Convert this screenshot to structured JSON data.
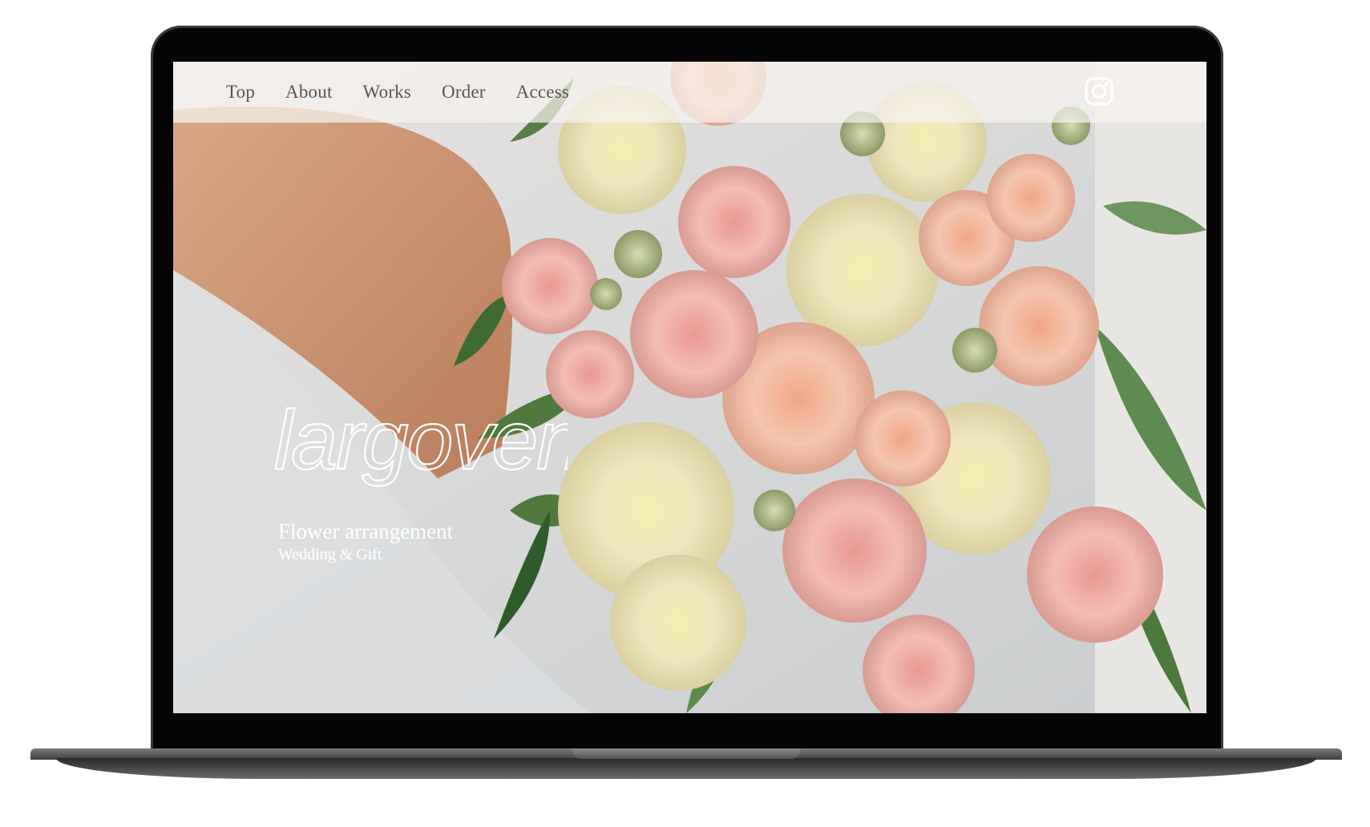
{
  "nav": {
    "items": [
      {
        "label": "Top"
      },
      {
        "label": "About"
      },
      {
        "label": "Works"
      },
      {
        "label": "Order"
      },
      {
        "label": "Access"
      }
    ],
    "social_icon": "instagram-icon"
  },
  "hero": {
    "brand": "largovent",
    "tagline": "Flower arrangement",
    "subtagline": "Wedding & Gift"
  },
  "colors": {
    "nav_bg": "#f6f3ef",
    "nav_text": "#5b5550",
    "hero_text": "#ffffff",
    "rose_cream": "#f3ecc0",
    "rose_peach": "#f2c0a8",
    "carnation_pink": "#eeb0a8",
    "leaf_green": "#4f7a3c"
  }
}
